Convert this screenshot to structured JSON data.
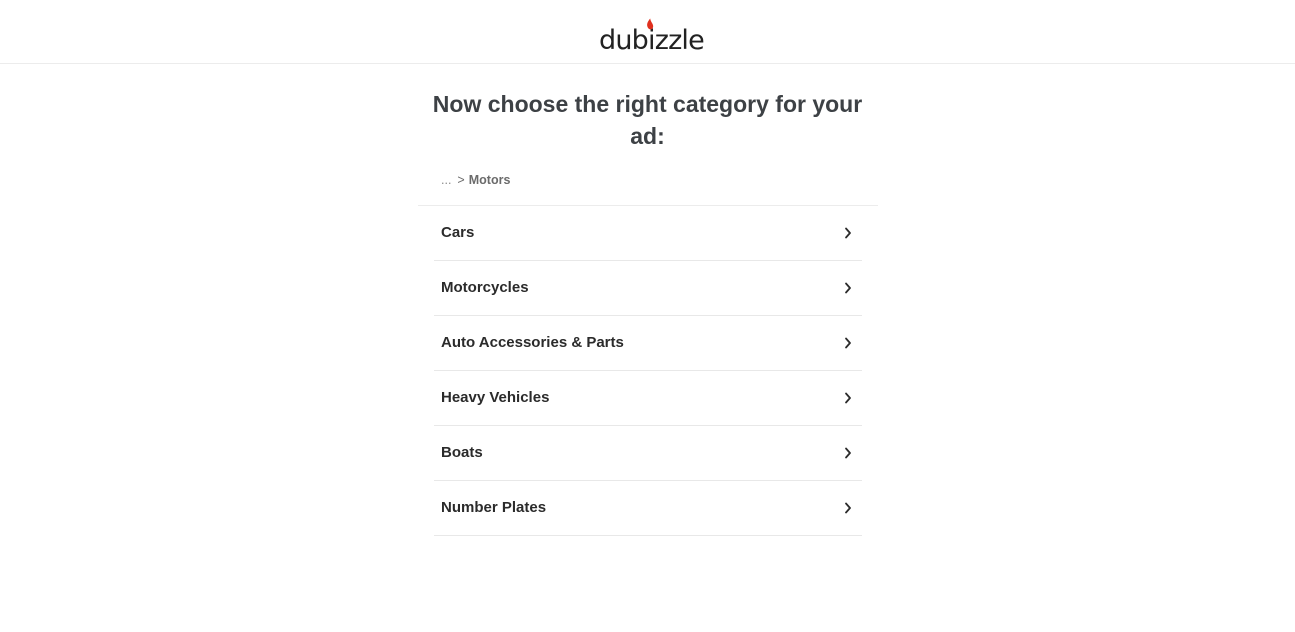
{
  "header": {
    "logo_text": "dubizzle",
    "brand_color": "#e0301e"
  },
  "page": {
    "title": "Now choose the right category for your ad:"
  },
  "breadcrumb": {
    "ellipsis": "...",
    "separator": ">",
    "current": "Motors"
  },
  "categories": [
    {
      "label": "Cars",
      "icon": "chevron-right-icon"
    },
    {
      "label": "Motorcycles",
      "icon": "chevron-right-icon"
    },
    {
      "label": "Auto Accessories & Parts",
      "icon": "chevron-right-icon"
    },
    {
      "label": "Heavy Vehicles",
      "icon": "chevron-right-icon"
    },
    {
      "label": "Boats",
      "icon": "chevron-right-icon"
    },
    {
      "label": "Number Plates",
      "icon": "chevron-right-icon"
    }
  ]
}
